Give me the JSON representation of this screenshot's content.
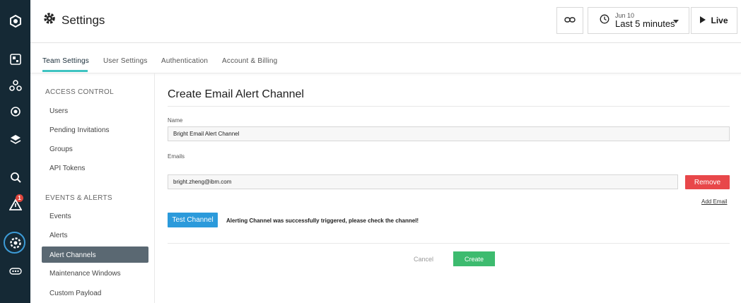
{
  "header": {
    "title": "Settings",
    "time_date": "Jun 10",
    "time_range": "Last 5 minutes",
    "live_label": "Live"
  },
  "tabs": [
    {
      "label": "Team Settings",
      "active": true
    },
    {
      "label": "User Settings",
      "active": false
    },
    {
      "label": "Authentication",
      "active": false
    },
    {
      "label": "Account & Billing",
      "active": false
    }
  ],
  "sidebar": {
    "access_control": {
      "heading": "ACCESS CONTROL",
      "items": [
        "Users",
        "Pending Invitations",
        "Groups",
        "API Tokens"
      ]
    },
    "events_alerts": {
      "heading": "EVENTS & ALERTS",
      "items": [
        "Events",
        "Alerts",
        "Alert Channels",
        "Maintenance Windows",
        "Custom Payload"
      ],
      "active": "Alert Channels"
    }
  },
  "rail": {
    "icons": [
      "instana-logo-icon",
      "dashboard-icon",
      "infrastructure-icon",
      "applications-icon",
      "platforms-icon",
      "analyze-icon",
      "events-icon",
      "settings-icon",
      "more-icon"
    ],
    "events_badge": "1"
  },
  "form": {
    "title": "Create Email Alert Channel",
    "name_label": "Name",
    "name_value": "Bright Email Alert Channel",
    "emails_label": "Emails",
    "email_value": "bright.zheng@ibm.com",
    "remove_label": "Remove",
    "add_email_label": "Add Email",
    "test_label": "Test Channel",
    "success_message": "Alerting Channel was successfully triggered, please check the channel!",
    "cancel_label": "Cancel",
    "create_label": "Create"
  },
  "colors": {
    "rail_bg": "#152935",
    "accent_tab": "#3ec3c1",
    "remove": "#e8474a",
    "test": "#2b9adb",
    "create": "#3dbb6f",
    "badge": "#e0463d"
  }
}
